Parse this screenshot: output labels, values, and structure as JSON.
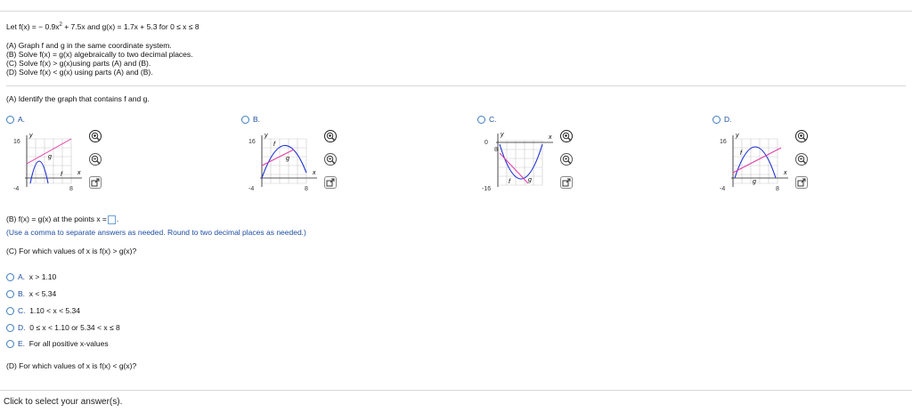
{
  "problem": {
    "statement_prefix": "Let f(x) = − 0.9x",
    "statement_exp": "2",
    "statement_suffix": " + 7.5x and g(x) = 1.7x + 5.3 for 0 ≤ x ≤ 8",
    "tasks": [
      "(A) Graph f and g in the same coordinate system.",
      "(B) Solve f(x) = g(x) algebraically to two decimal places.",
      "(C) Solve f(x) > g(x)using parts (A) and (B).",
      "(D) Solve f(x) < g(x) using parts (A) and (B)."
    ]
  },
  "part_a": {
    "prompt": "(A) Identify the graph that contains f and g.",
    "options": [
      {
        "letter": "A.",
        "ymax": "16",
        "ymin": "-4",
        "xmax": "8",
        "y_label": "y",
        "x_label": "x",
        "f_label": "f",
        "g_label": "g"
      },
      {
        "letter": "B.",
        "ymax": "16",
        "ymin": "-4",
        "xmax": "8",
        "y_label": "y",
        "x_label": "x",
        "f_label": "f",
        "g_label": "g"
      },
      {
        "letter": "C.",
        "ymax": "0",
        "ymin": "-16",
        "xmax": "8",
        "y_label": "y",
        "x_label": "x",
        "f_label": "f",
        "g_label": "g"
      },
      {
        "letter": "D.",
        "ymax": "16",
        "ymin": "-4",
        "xmax": "8",
        "y_label": "y",
        "x_label": "x",
        "f_label": "f",
        "g_label": "g"
      }
    ]
  },
  "part_b": {
    "prompt": "(B) f(x) = g(x) at the points x =",
    "hint": "(Use a comma to separate answers as needed. Round to two decimal places as needed.)"
  },
  "part_c": {
    "prompt": "(C) For which values of x is f(x) > g(x)?",
    "options": [
      {
        "letter": "A.",
        "text": "x > 1.10"
      },
      {
        "letter": "B.",
        "text": "x < 5.34"
      },
      {
        "letter": "C.",
        "text": "1.10 < x < 5.34"
      },
      {
        "letter": "D.",
        "text": "0 ≤ x < 1.10  or 5.34 < x ≤ 8"
      },
      {
        "letter": "E.",
        "text": "For all positive x-values"
      }
    ]
  },
  "part_d": {
    "prompt": "(D) For which values of x is f(x) < g(x)?"
  },
  "footer": {
    "status": "Click to select your answer(s)."
  },
  "colors": {
    "f_curve": "#1a2fd6",
    "g_line": "#e23aa6",
    "grid": "#c9c9c9",
    "radio": "#3b7dc4"
  }
}
